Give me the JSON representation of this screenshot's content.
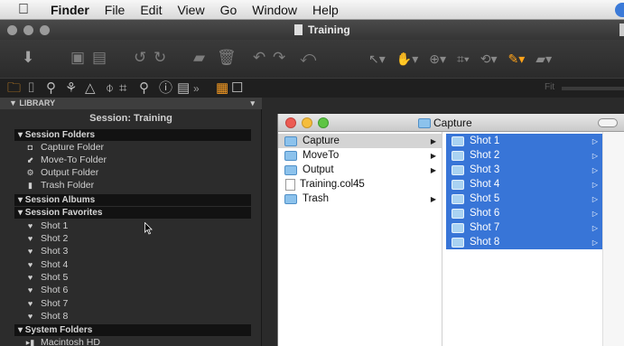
{
  "menubar": {
    "items": [
      "Finder",
      "File",
      "Edit",
      "View",
      "Go",
      "Window",
      "Help"
    ]
  },
  "window": {
    "title": "Training"
  },
  "toolbar": {
    "fit_label": "Fit"
  },
  "library": {
    "header": "▼ LIBRARY",
    "session_title": "Session: Training",
    "sections": {
      "session_folders": "▾ Session Folders",
      "session_albums": "▾ Session Albums",
      "session_favorites": "▾ Session Favorites",
      "system_folders": "▾ System Folders"
    },
    "session_folders": [
      "Capture Folder",
      "Move-To Folder",
      "Output Folder",
      "Trash Folder"
    ],
    "favorites": [
      "Shot 1",
      "Shot 2",
      "Shot 3",
      "Shot 4",
      "Shot 5",
      "Shot 6",
      "Shot 7",
      "Shot 8"
    ],
    "system_folders": [
      "Macintosh HD"
    ]
  },
  "finder": {
    "title": "Capture",
    "col1": [
      {
        "name": "Capture",
        "type": "folder",
        "arrow": "▶",
        "selected": true
      },
      {
        "name": "MoveTo",
        "type": "folder",
        "arrow": "▶",
        "selected": false
      },
      {
        "name": "Output",
        "type": "folder",
        "arrow": "▶",
        "selected": false
      },
      {
        "name": "Training.col45",
        "type": "document",
        "arrow": "",
        "selected": false
      },
      {
        "name": "Trash",
        "type": "folder",
        "arrow": "▶",
        "selected": false
      }
    ],
    "col2": [
      "Shot 1",
      "Shot 2",
      "Shot 3",
      "Shot 4",
      "Shot 5",
      "Shot 6",
      "Shot 7",
      "Shot 8"
    ],
    "col2_arrow": "▷"
  },
  "colors": {
    "accent": "#f59a22",
    "selection": "#3875d7"
  }
}
